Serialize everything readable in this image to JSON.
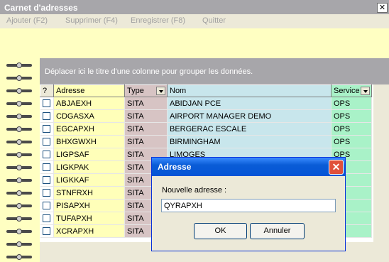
{
  "window": {
    "title": "Carnet d'adresses",
    "close_glyph": "✕"
  },
  "menu": [
    {
      "label": "Ajouter (F2)"
    },
    {
      "label": "Supprimer (F4)"
    },
    {
      "label": "Enregistrer (F8)"
    },
    {
      "label": "Quitter"
    }
  ],
  "group_panel": {
    "text": "Déplacer ici le titre d'une colonne pour grouper les données."
  },
  "grid": {
    "columns": {
      "check": "?",
      "adresse": "Adresse",
      "type": "Type",
      "nom": "Nom",
      "service": "Service"
    },
    "rows": [
      {
        "adresse": "ABJAEXH",
        "type": "SITA",
        "nom": "ABIDJAN PCE",
        "service": "OPS"
      },
      {
        "adresse": "CDGASXA",
        "type": "SITA",
        "nom": "AIRPORT MANAGER  DEMO",
        "service": "OPS"
      },
      {
        "adresse": "EGCAPXH",
        "type": "SITA",
        "nom": "BERGERAC ESCALE",
        "service": "OPS"
      },
      {
        "adresse": "BHXGWXH",
        "type": "SITA",
        "nom": "BIRMINGHAM",
        "service": "OPS"
      },
      {
        "adresse": "LIGPSAF",
        "type": "SITA",
        "nom": "LIMOGES",
        "service": "OPS"
      },
      {
        "adresse": "LIGKPAK",
        "type": "SITA",
        "nom": "",
        "service": ""
      },
      {
        "adresse": "LIGKKAF",
        "type": "SITA",
        "nom": "",
        "service": ""
      },
      {
        "adresse": "STNFRXH",
        "type": "SITA",
        "nom": "",
        "service": ""
      },
      {
        "adresse": "PISAPXH",
        "type": "SITA",
        "nom": "",
        "service": ""
      },
      {
        "adresse": "TUFAPXH",
        "type": "SITA",
        "nom": "",
        "service": ""
      },
      {
        "adresse": "XCRAPXH",
        "type": "SITA",
        "nom": "",
        "service": ""
      }
    ]
  },
  "dialog": {
    "title": "Adresse",
    "close_glyph": "✕",
    "label": "Nouvelle adresse :",
    "input_value": "QYRAPXH",
    "ok_label": "OK",
    "cancel_label": "Annuler"
  },
  "colors": {
    "title_bar": "#a7a6aa",
    "dialog_title": "#0a5cd6",
    "adresse_col": "#ffffb9",
    "type_col": "#d7c4c4",
    "nom_col": "#c8e6ec",
    "service_col": "#a9f2c8"
  }
}
